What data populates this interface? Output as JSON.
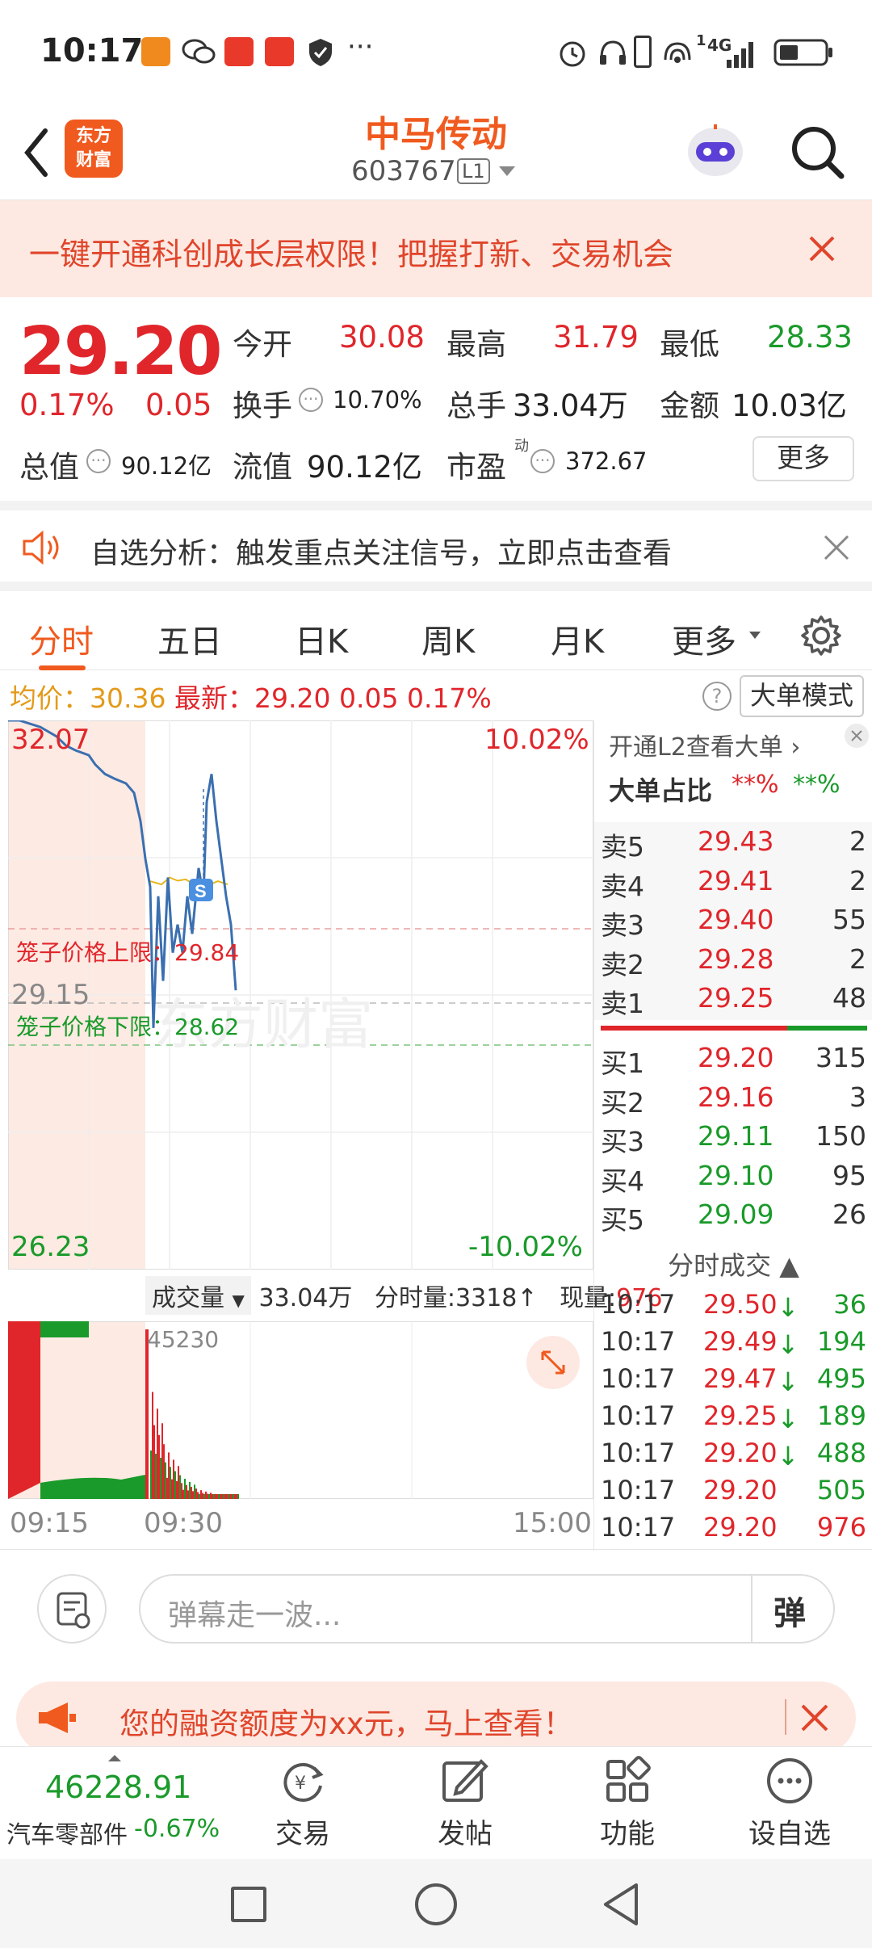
{
  "status_bar": {
    "time": "10:17",
    "network": "4G",
    "sim": "1"
  },
  "header": {
    "logo_line1": "东方",
    "logo_line2": "财富",
    "stock_name": "中马传动",
    "stock_code": "603767",
    "level_badge": "L1"
  },
  "banner": {
    "text": "一键开通科创成长层权限！把握打新、交易机会"
  },
  "quote": {
    "price": "29.20",
    "change_pct": "0.17%",
    "change": "0.05",
    "open_label": "今开",
    "open": "30.08",
    "high_label": "最高",
    "high": "31.79",
    "low_label": "最低",
    "low": "28.33",
    "turnover_label": "换手",
    "turnover": "10.70%",
    "volume_label": "总手",
    "volume": "33.04万",
    "amount_label": "金额",
    "amount": "10.03亿",
    "mktcap_label": "总值",
    "mktcap": "90.12亿",
    "float_label": "流值",
    "float_cap": "90.12亿",
    "pe_label": "市盈",
    "pe_sup": "动",
    "pe": "372.67",
    "more_button": "更多"
  },
  "notice": {
    "text": "自选分析：触发重点关注信号，立即点击查看"
  },
  "tabs": [
    {
      "label": "分时",
      "active": true
    },
    {
      "label": "五日"
    },
    {
      "label": "日K"
    },
    {
      "label": "周K"
    },
    {
      "label": "月K"
    },
    {
      "label": "更多"
    }
  ],
  "info_bar": {
    "avg_label": "均价：",
    "avg": "30.36",
    "latest_label": "最新：",
    "latest": "29.20",
    "chg": "0.05",
    "pct": "0.17%",
    "mode_button": "大单模式"
  },
  "intraday": {
    "y_top": "32.07",
    "y_top_pct": "10.02%",
    "y_bottom": "26.23",
    "y_bottom_pct": "-10.02%",
    "y_mid": "29.15",
    "upper_limit_label": "笼子价格上限：",
    "upper_limit": "29.84",
    "lower_limit_label": "笼子价格下限：",
    "lower_limit": "28.62",
    "watermark": "东方财富",
    "marker": "S",
    "price_series": [
      32.07,
      32.07,
      32.0,
      31.9,
      31.8,
      31.75,
      31.7,
      31.6,
      31.5,
      31.45,
      31.4,
      31.3,
      31.0,
      30.6,
      30.3,
      28.8,
      30.2,
      29.3,
      30.4,
      29.6,
      29.9,
      29.6,
      30.2,
      29.8,
      30.5,
      30.2,
      31.2,
      31.5,
      31.0,
      30.6,
      30.2,
      29.9,
      29.2
    ],
    "avg_series": [
      30.36,
      30.36,
      30.4,
      30.4,
      30.38,
      30.36,
      30.36,
      30.36,
      30.36,
      30.36
    ],
    "volume_header": {
      "selector": "成交量",
      "total": "33.04万",
      "period_label": "分时量:",
      "period": "3318↑",
      "current_label": "现量:",
      "current": "976"
    },
    "volume_peak_label": "45230",
    "time_labels": [
      "09:15",
      "09:30",
      "15:00"
    ]
  },
  "order_book": {
    "upgrade_link": "开通L2查看大单",
    "ratio_label": "大单占比",
    "ratio_sell": "**%",
    "ratio_buy": "**%",
    "asks": [
      {
        "label": "卖5",
        "price": "29.43",
        "vol": "2"
      },
      {
        "label": "卖4",
        "price": "29.41",
        "vol": "2"
      },
      {
        "label": "卖3",
        "price": "29.40",
        "vol": "55"
      },
      {
        "label": "卖2",
        "price": "29.28",
        "vol": "2"
      },
      {
        "label": "卖1",
        "price": "29.25",
        "vol": "48"
      }
    ],
    "bids": [
      {
        "label": "买1",
        "price": "29.20",
        "vol": "315"
      },
      {
        "label": "买2",
        "price": "29.16",
        "vol": "3"
      },
      {
        "label": "买3",
        "price": "29.11",
        "vol": "150"
      },
      {
        "label": "买4",
        "price": "29.10",
        "vol": "95"
      },
      {
        "label": "买5",
        "price": "29.09",
        "vol": "26"
      }
    ],
    "trades_header": "分时成交",
    "trades": [
      {
        "time": "10:17",
        "price": "29.50↓",
        "vol": "36",
        "color": "green"
      },
      {
        "time": "10:17",
        "price": "29.49↓",
        "vol": "194",
        "color": "green"
      },
      {
        "time": "10:17",
        "price": "29.47↓",
        "vol": "495",
        "color": "green"
      },
      {
        "time": "10:17",
        "price": "29.25↓",
        "vol": "189",
        "color": "green"
      },
      {
        "time": "10:17",
        "price": "29.20↓",
        "vol": "488",
        "color": "green"
      },
      {
        "time": "10:17",
        "price": "29.20",
        "vol": "505",
        "color": "green"
      },
      {
        "time": "10:17",
        "price": "29.20",
        "vol": "976",
        "color": "red"
      }
    ]
  },
  "danmu": {
    "placeholder": "弹幕走一波...",
    "button": "弹"
  },
  "promo": {
    "text": "您的融资额度为xx元，马上查看！"
  },
  "bottom_nav": {
    "index_value": "46228.91",
    "index_name": "汽车零部件",
    "index_change": "-0.67%",
    "items": [
      {
        "label": "交易"
      },
      {
        "label": "发帖"
      },
      {
        "label": "功能"
      },
      {
        "label": "设自选"
      }
    ]
  },
  "colors": {
    "up": "#e0262b",
    "down": "#1a9a2a",
    "accent": "#f05a1e",
    "line": "#3a6fb0"
  }
}
